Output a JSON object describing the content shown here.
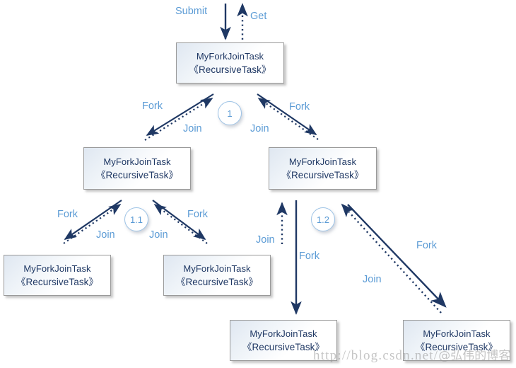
{
  "diagram": {
    "title": "ForkJoinTask recursive fork/join structure",
    "colors": {
      "arrow": "#1f3864",
      "label": "#5b9bd5",
      "box_text": "#1f3864",
      "box_border": "#9a9a9a",
      "circle_border": "#9dc3e6",
      "background": "#ffffff"
    },
    "task_label_line1": "MyForkJoinTask",
    "task_label_line2": "《RecursiveTask》",
    "nodes": [
      {
        "id": "root",
        "line1": "MyForkJoinTask",
        "line2": "《RecursiveTask》"
      },
      {
        "id": "n1",
        "line1": "MyForkJoinTask",
        "line2": "《RecursiveTask》"
      },
      {
        "id": "n2",
        "line1": "MyForkJoinTask",
        "line2": "《RecursiveTask》"
      },
      {
        "id": "n1a",
        "line1": "MyForkJoinTask",
        "line2": "《RecursiveTask》"
      },
      {
        "id": "n1b",
        "line1": "MyForkJoinTask",
        "line2": "《RecursiveTask》"
      },
      {
        "id": "n2a",
        "line1": "MyForkJoinTask",
        "line2": "《RecursiveTask》"
      },
      {
        "id": "n2b",
        "line1": "MyForkJoinTask",
        "line2": "《RecursiveTask》"
      }
    ],
    "steps": [
      {
        "id": "step-1",
        "label": "1"
      },
      {
        "id": "step-1-1",
        "label": "1.1"
      },
      {
        "id": "step-1-2",
        "label": "1.2"
      }
    ],
    "labels": {
      "submit": "Submit",
      "get": "Get",
      "fork": "Fork",
      "join": "Join",
      "fork_l1_left": "Fork",
      "join_l1_left": "Join",
      "fork_l1_right": "Fork",
      "join_l1_right": "Join",
      "fork_l2a_left": "Fork",
      "join_l2a_left": "Join",
      "fork_l2a_right": "Fork",
      "join_l2a_right": "Join",
      "join_l2b_vert": "Join",
      "fork_l2b_vert": "Fork",
      "fork_l2b_diag": "Fork",
      "join_l2b_diag": "Join"
    },
    "watermark": {
      "url": "http://blog.csdn.net/",
      "handle": "@弘伟的博客"
    }
  }
}
